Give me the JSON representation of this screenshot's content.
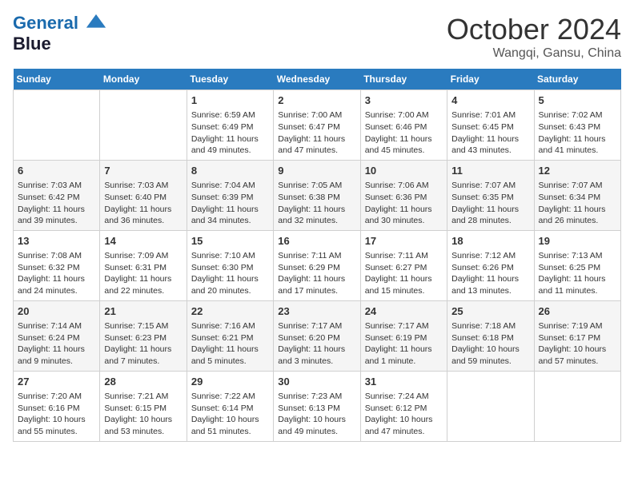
{
  "header": {
    "logo_line1": "General",
    "logo_line2": "Blue",
    "title": "October 2024",
    "location": "Wangqi, Gansu, China"
  },
  "days_of_week": [
    "Sunday",
    "Monday",
    "Tuesday",
    "Wednesday",
    "Thursday",
    "Friday",
    "Saturday"
  ],
  "weeks": [
    [
      null,
      null,
      {
        "day": "1",
        "sunrise": "Sunrise: 6:59 AM",
        "sunset": "Sunset: 6:49 PM",
        "daylight": "Daylight: 11 hours and 49 minutes."
      },
      {
        "day": "2",
        "sunrise": "Sunrise: 7:00 AM",
        "sunset": "Sunset: 6:47 PM",
        "daylight": "Daylight: 11 hours and 47 minutes."
      },
      {
        "day": "3",
        "sunrise": "Sunrise: 7:00 AM",
        "sunset": "Sunset: 6:46 PM",
        "daylight": "Daylight: 11 hours and 45 minutes."
      },
      {
        "day": "4",
        "sunrise": "Sunrise: 7:01 AM",
        "sunset": "Sunset: 6:45 PM",
        "daylight": "Daylight: 11 hours and 43 minutes."
      },
      {
        "day": "5",
        "sunrise": "Sunrise: 7:02 AM",
        "sunset": "Sunset: 6:43 PM",
        "daylight": "Daylight: 11 hours and 41 minutes."
      }
    ],
    [
      {
        "day": "6",
        "sunrise": "Sunrise: 7:03 AM",
        "sunset": "Sunset: 6:42 PM",
        "daylight": "Daylight: 11 hours and 39 minutes."
      },
      {
        "day": "7",
        "sunrise": "Sunrise: 7:03 AM",
        "sunset": "Sunset: 6:40 PM",
        "daylight": "Daylight: 11 hours and 36 minutes."
      },
      {
        "day": "8",
        "sunrise": "Sunrise: 7:04 AM",
        "sunset": "Sunset: 6:39 PM",
        "daylight": "Daylight: 11 hours and 34 minutes."
      },
      {
        "day": "9",
        "sunrise": "Sunrise: 7:05 AM",
        "sunset": "Sunset: 6:38 PM",
        "daylight": "Daylight: 11 hours and 32 minutes."
      },
      {
        "day": "10",
        "sunrise": "Sunrise: 7:06 AM",
        "sunset": "Sunset: 6:36 PM",
        "daylight": "Daylight: 11 hours and 30 minutes."
      },
      {
        "day": "11",
        "sunrise": "Sunrise: 7:07 AM",
        "sunset": "Sunset: 6:35 PM",
        "daylight": "Daylight: 11 hours and 28 minutes."
      },
      {
        "day": "12",
        "sunrise": "Sunrise: 7:07 AM",
        "sunset": "Sunset: 6:34 PM",
        "daylight": "Daylight: 11 hours and 26 minutes."
      }
    ],
    [
      {
        "day": "13",
        "sunrise": "Sunrise: 7:08 AM",
        "sunset": "Sunset: 6:32 PM",
        "daylight": "Daylight: 11 hours and 24 minutes."
      },
      {
        "day": "14",
        "sunrise": "Sunrise: 7:09 AM",
        "sunset": "Sunset: 6:31 PM",
        "daylight": "Daylight: 11 hours and 22 minutes."
      },
      {
        "day": "15",
        "sunrise": "Sunrise: 7:10 AM",
        "sunset": "Sunset: 6:30 PM",
        "daylight": "Daylight: 11 hours and 20 minutes."
      },
      {
        "day": "16",
        "sunrise": "Sunrise: 7:11 AM",
        "sunset": "Sunset: 6:29 PM",
        "daylight": "Daylight: 11 hours and 17 minutes."
      },
      {
        "day": "17",
        "sunrise": "Sunrise: 7:11 AM",
        "sunset": "Sunset: 6:27 PM",
        "daylight": "Daylight: 11 hours and 15 minutes."
      },
      {
        "day": "18",
        "sunrise": "Sunrise: 7:12 AM",
        "sunset": "Sunset: 6:26 PM",
        "daylight": "Daylight: 11 hours and 13 minutes."
      },
      {
        "day": "19",
        "sunrise": "Sunrise: 7:13 AM",
        "sunset": "Sunset: 6:25 PM",
        "daylight": "Daylight: 11 hours and 11 minutes."
      }
    ],
    [
      {
        "day": "20",
        "sunrise": "Sunrise: 7:14 AM",
        "sunset": "Sunset: 6:24 PM",
        "daylight": "Daylight: 11 hours and 9 minutes."
      },
      {
        "day": "21",
        "sunrise": "Sunrise: 7:15 AM",
        "sunset": "Sunset: 6:23 PM",
        "daylight": "Daylight: 11 hours and 7 minutes."
      },
      {
        "day": "22",
        "sunrise": "Sunrise: 7:16 AM",
        "sunset": "Sunset: 6:21 PM",
        "daylight": "Daylight: 11 hours and 5 minutes."
      },
      {
        "day": "23",
        "sunrise": "Sunrise: 7:17 AM",
        "sunset": "Sunset: 6:20 PM",
        "daylight": "Daylight: 11 hours and 3 minutes."
      },
      {
        "day": "24",
        "sunrise": "Sunrise: 7:17 AM",
        "sunset": "Sunset: 6:19 PM",
        "daylight": "Daylight: 11 hours and 1 minute."
      },
      {
        "day": "25",
        "sunrise": "Sunrise: 7:18 AM",
        "sunset": "Sunset: 6:18 PM",
        "daylight": "Daylight: 10 hours and 59 minutes."
      },
      {
        "day": "26",
        "sunrise": "Sunrise: 7:19 AM",
        "sunset": "Sunset: 6:17 PM",
        "daylight": "Daylight: 10 hours and 57 minutes."
      }
    ],
    [
      {
        "day": "27",
        "sunrise": "Sunrise: 7:20 AM",
        "sunset": "Sunset: 6:16 PM",
        "daylight": "Daylight: 10 hours and 55 minutes."
      },
      {
        "day": "28",
        "sunrise": "Sunrise: 7:21 AM",
        "sunset": "Sunset: 6:15 PM",
        "daylight": "Daylight: 10 hours and 53 minutes."
      },
      {
        "day": "29",
        "sunrise": "Sunrise: 7:22 AM",
        "sunset": "Sunset: 6:14 PM",
        "daylight": "Daylight: 10 hours and 51 minutes."
      },
      {
        "day": "30",
        "sunrise": "Sunrise: 7:23 AM",
        "sunset": "Sunset: 6:13 PM",
        "daylight": "Daylight: 10 hours and 49 minutes."
      },
      {
        "day": "31",
        "sunrise": "Sunrise: 7:24 AM",
        "sunset": "Sunset: 6:12 PM",
        "daylight": "Daylight: 10 hours and 47 minutes."
      },
      null,
      null
    ]
  ]
}
